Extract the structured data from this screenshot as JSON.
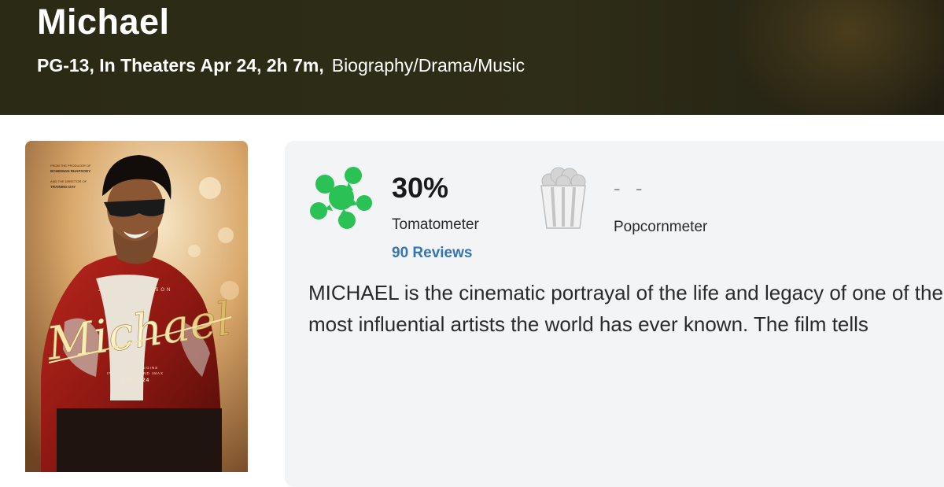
{
  "movie": {
    "title": "Michael",
    "info": "PG-13, In Theaters Apr 24, 2h 7m,",
    "genre": "Biography/Drama/Music"
  },
  "poster": {
    "top_credit_1": "FROM THE PRODUCER OF",
    "top_credit_2": "BOHEMIAN RHAPSODY",
    "top_credit_3": "AND THE DIRECTOR OF",
    "top_credit_4": "TRAINING DAY",
    "actor": "JAAFAR JACKSON",
    "logo": "Michael",
    "tagline_1": "HIS STORY BEGINS",
    "tagline_2": "IN THEATERS AND IMAX",
    "date": "APRIL 24"
  },
  "scores": {
    "tomatometer": {
      "value": "30%",
      "label": "Tomatometer",
      "reviews": "90 Reviews",
      "icon": "splat-icon",
      "color": "#2ac155"
    },
    "popcornmeter": {
      "value": "- -",
      "label": "Popcornmeter",
      "icon": "popcorn-bucket-icon"
    }
  },
  "synopsis": {
    "line1": "MICHAEL is the cinematic portrayal of the life and legacy of one of the",
    "line2": "most influential artists the world has ever known. The film tells"
  }
}
